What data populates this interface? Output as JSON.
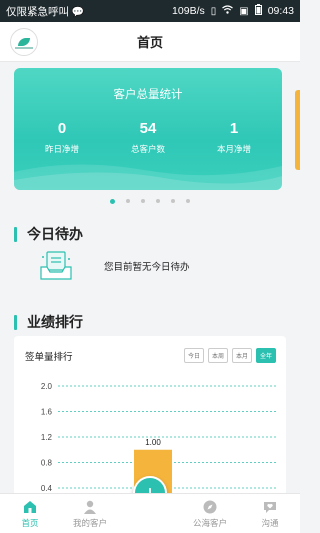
{
  "status_bar": {
    "carrier": "仅限紧急呼叫",
    "speed": "109B/s",
    "time": "09:43"
  },
  "header": {
    "title": "首页",
    "logo_icon": "brand-logo-icon"
  },
  "banner": {
    "title": "客户总量统计",
    "stats": [
      {
        "value": "0",
        "label": "昨日净增"
      },
      {
        "value": "54",
        "label": "总客户数"
      },
      {
        "value": "1",
        "label": "本月净增"
      }
    ],
    "page_dots": 6,
    "active_dot": 0
  },
  "todo": {
    "section_title": "今日待办",
    "empty_text": "您目前暂无今日待办",
    "icon": "empty-tray-icon"
  },
  "ranking": {
    "section_title": "业绩排行",
    "card_title": "签单量排行",
    "tabs": [
      "今日",
      "本周",
      "本月",
      "全年"
    ],
    "active_tab": 3
  },
  "chart_data": {
    "type": "bar",
    "y_ticks": [
      "2.0",
      "1.6",
      "1.2",
      "0.8",
      "0.4"
    ],
    "ylim": [
      0,
      2.0
    ],
    "categories": [
      ""
    ],
    "values": [
      1.0
    ],
    "data_labels": [
      "1.00"
    ],
    "bar_color": "#f5b43c",
    "grid": true
  },
  "tabbar": {
    "items": [
      {
        "label": "首页",
        "icon": "home-icon",
        "active": true
      },
      {
        "label": "我的客户",
        "icon": "user-icon",
        "active": false
      },
      {
        "label": "",
        "icon": "add-icon",
        "active": false
      },
      {
        "label": "公海客户",
        "icon": "compass-icon",
        "active": false
      },
      {
        "label": "沟通",
        "icon": "chat-heart-icon",
        "active": false
      }
    ],
    "fab_symbol": "+"
  },
  "colors": {
    "accent": "#2bc0b0",
    "bar": "#f5b43c",
    "status_bar": "#1f2a2e"
  }
}
